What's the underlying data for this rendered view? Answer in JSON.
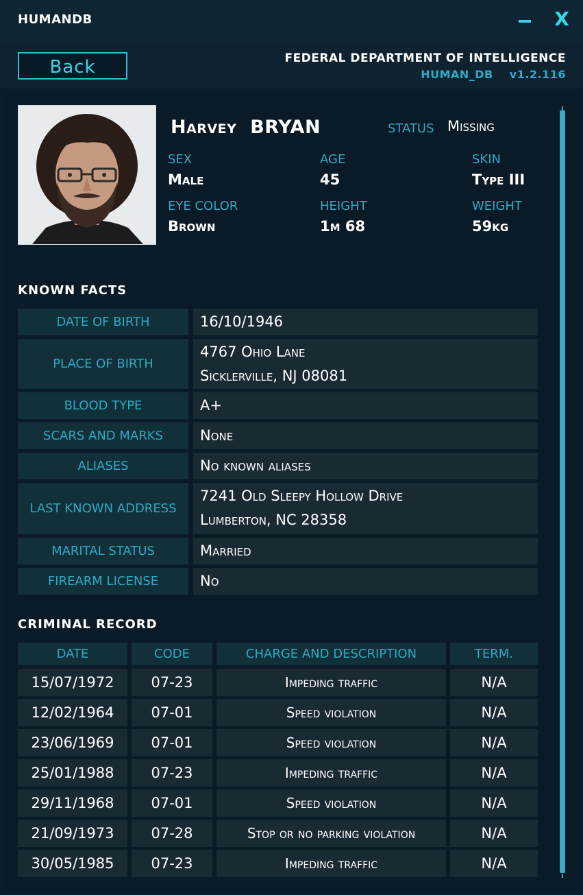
{
  "window": {
    "title": "HUMANDB",
    "minimize_label": "–",
    "close_label": "X"
  },
  "header": {
    "back_label": "Back",
    "agency": "FEDERAL DEPARTMENT OF INTELLIGENCE",
    "db_name": "HUMAN_DB",
    "version": "v1.2.116"
  },
  "profile": {
    "first_name": "Harvey",
    "last_name": "BRYAN",
    "status_label": "STATUS",
    "status_value": "Missing",
    "sex_label": "SEX",
    "sex_value": "Male",
    "age_label": "AGE",
    "age_value": "45",
    "skin_label": "SKIN",
    "skin_value": "Type III",
    "eye_label": "EYE COLOR",
    "eye_value": "Brown",
    "height_label": "HEIGHT",
    "height_value": "1m 68",
    "weight_label": "WEIGHT",
    "weight_value": "59kg"
  },
  "known_facts": {
    "title": "KNOWN  FACTS",
    "rows": [
      {
        "label": "DATE OF BIRTH",
        "line1": "16/10/1946",
        "line2": ""
      },
      {
        "label": "PLACE OF BIRTH",
        "line1": "4767 Ohio Lane",
        "line2": "Sicklerville, NJ 08081"
      },
      {
        "label": "BLOOD TYPE",
        "line1": "A+",
        "line2": ""
      },
      {
        "label": "SCARS AND MARKS",
        "line1": "None",
        "line2": ""
      },
      {
        "label": "ALIASES",
        "line1": "No known aliases",
        "line2": ""
      },
      {
        "label": "LAST KNOWN ADDRESS",
        "line1": "7241 Old Sleepy Hollow Drive",
        "line2": "Lumberton, NC 28358"
      },
      {
        "label": "MARITAL STATUS",
        "line1": "Married",
        "line2": ""
      },
      {
        "label": "FIREARM LICENSE",
        "line1": "No",
        "line2": ""
      }
    ]
  },
  "criminal_record": {
    "title": "CRIMINAL  RECORD",
    "columns": [
      "DATE",
      "CODE",
      "CHARGE AND DESCRIPTION",
      "TERM."
    ],
    "rows": [
      {
        "date": "15/07/1972",
        "code": "07-23",
        "charge": "Impeding traffic",
        "term": "N/A"
      },
      {
        "date": "12/02/1964",
        "code": "07-01",
        "charge": "Speed violation",
        "term": "N/A"
      },
      {
        "date": "23/06/1969",
        "code": "07-01",
        "charge": "Speed violation",
        "term": "N/A"
      },
      {
        "date": "25/01/1988",
        "code": "07-23",
        "charge": "Impeding traffic",
        "term": "N/A"
      },
      {
        "date": "29/11/1968",
        "code": "07-01",
        "charge": "Speed violation",
        "term": "N/A"
      },
      {
        "date": "21/09/1973",
        "code": "07-28",
        "charge": "Stop or no parking violation",
        "term": "N/A"
      },
      {
        "date": "30/05/1985",
        "code": "07-23",
        "charge": "Impeding traffic",
        "term": "N/A"
      }
    ]
  },
  "colors": {
    "accent": "#38d6e8",
    "label": "#2fa9c2",
    "background": "#0b1d2a",
    "label_cell": "#11303a",
    "value_cell": "#1a2a33"
  }
}
